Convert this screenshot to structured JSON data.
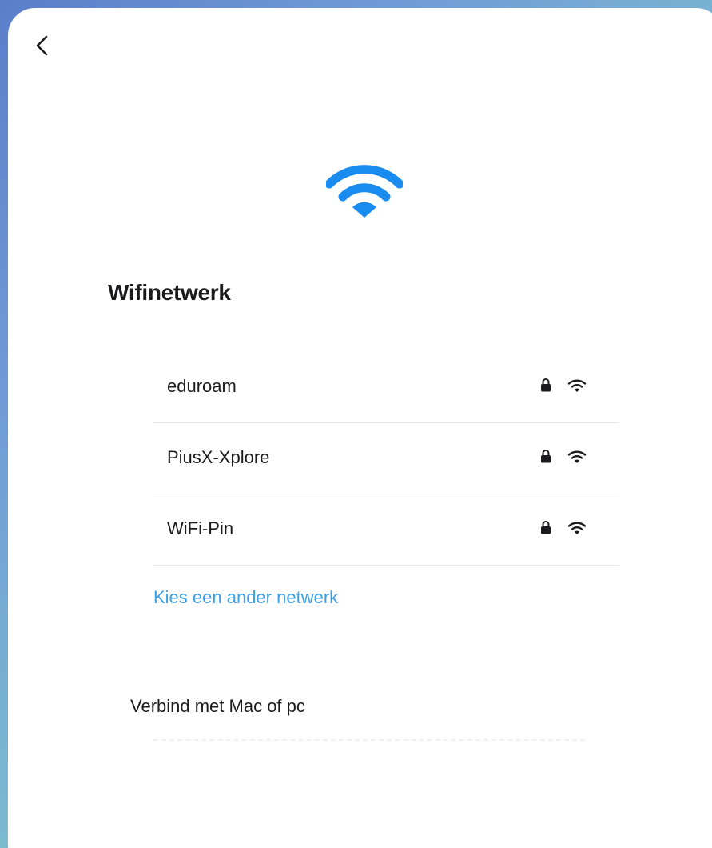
{
  "header": {
    "back_icon": "chevron-left-icon"
  },
  "hero": {
    "icon": "wifi-icon",
    "color": "#1a8cf0"
  },
  "title": "Wifinetwerk",
  "networks": [
    {
      "name": "eduroam",
      "secured": true,
      "lock_icon": "lock-icon",
      "signal_icon": "wifi-signal-icon"
    },
    {
      "name": "PiusX-Xplore",
      "secured": true,
      "lock_icon": "lock-icon",
      "signal_icon": "wifi-signal-icon"
    },
    {
      "name": "WiFi-Pin",
      "secured": true,
      "lock_icon": "lock-icon",
      "signal_icon": "wifi-signal-icon"
    }
  ],
  "other_network_link": "Kies een ander netwerk",
  "connect_section": {
    "label": "Verbind met Mac of pc"
  },
  "colors": {
    "accent_link": "#3aa0e4",
    "text_primary": "#1c1c1e",
    "divider": "#e6e6e8"
  }
}
